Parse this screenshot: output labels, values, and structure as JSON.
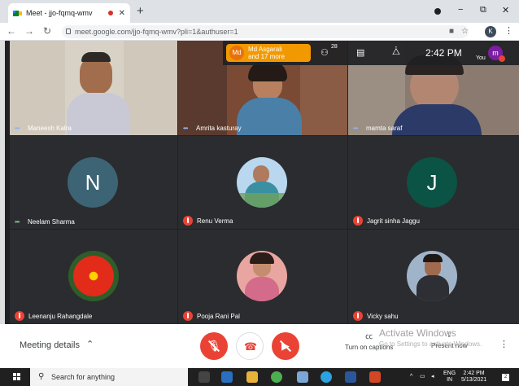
{
  "browser": {
    "tab_title": "Meet - jjo-fqmq-wmv",
    "tab_close": "✕",
    "new_tab": "+",
    "url": "meet.google.com/jjo-fqmq-wmv?pli=1&authuser=1",
    "profile_initial": "K",
    "window_controls": [
      "−",
      "⧉",
      "✕"
    ]
  },
  "meet": {
    "host_badge": {
      "initials": "Md",
      "line1": "Md Asgarali",
      "line2": "and 17 more"
    },
    "participant_count": "28",
    "time": "2:42 PM",
    "self_label": "You",
    "self_initial": "m",
    "participants": [
      {
        "name": "Maneesh Kalra",
        "status": "speaking"
      },
      {
        "name": "Amrita kasturay",
        "status": "speaking"
      },
      {
        "name": "mamta saraf",
        "status": "speaking"
      },
      {
        "name": "Neelam Sharma",
        "status": "speaking",
        "avatar_letter": "N",
        "avatar_color": "#3c6474"
      },
      {
        "name": "Renu Verma",
        "status": "muted"
      },
      {
        "name": "Jagrit sinha Jaggu",
        "status": "muted",
        "avatar_letter": "J",
        "avatar_color": "#0b5345"
      },
      {
        "name": "Leenanju Rahangdale",
        "status": "muted"
      },
      {
        "name": "Pooja Rani Pal",
        "status": "muted"
      },
      {
        "name": "Vicky sahu",
        "status": "muted"
      }
    ]
  },
  "controls": {
    "meeting_details": "Meeting details",
    "captions_label": "Turn on captions",
    "present_label": "Present now",
    "activate_title": "Activate Windows",
    "activate_sub": "Go to Settings to activate Windows."
  },
  "taskbar": {
    "search_placeholder": "Search for anything",
    "lang": "ENG",
    "region": "IN",
    "time": "2:42 PM",
    "date": "5/13/2021",
    "notifications": "2"
  },
  "colors": {
    "accent": "#1a73e8",
    "danger": "#ea4335",
    "meet_bg": "#202124"
  }
}
